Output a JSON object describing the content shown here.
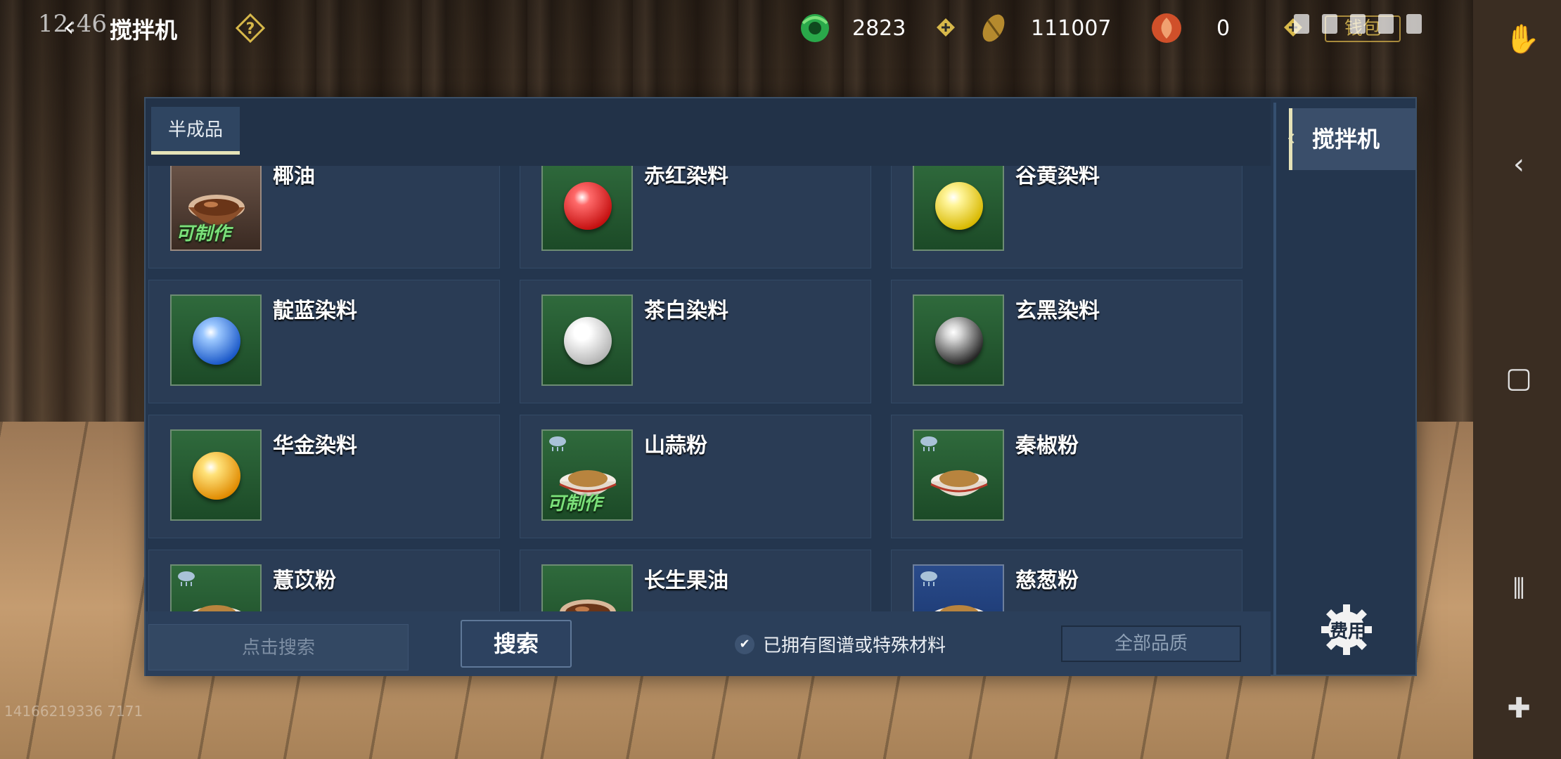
{
  "status": {
    "time": "12:46"
  },
  "header": {
    "title": "搅拌机",
    "back_icon": "back-arrow-icon",
    "help_icon": "question-diamond-icon",
    "ghost_button": "钱包"
  },
  "resources": [
    {
      "icon": "jade-coin-icon",
      "value": "2823",
      "color": "#2aa84a"
    },
    {
      "icon": "copper-coin-icon",
      "value": "111007",
      "color": "#b58a2e"
    },
    {
      "icon": "red-token-icon",
      "value": "0",
      "color": "#d0502a"
    }
  ],
  "tabs": [
    {
      "label": "半成品",
      "active": true
    }
  ],
  "side_tabs": [
    {
      "label": "搅拌机",
      "active": true
    }
  ],
  "items": [
    {
      "name": "椰油",
      "icon": "oil-bowl-icon",
      "craftable": true,
      "rain": false,
      "bg": "gray",
      "orb": "brown"
    },
    {
      "name": "赤红染料",
      "icon": "red-orb-icon",
      "craftable": false,
      "rain": false,
      "bg": "green",
      "orb": "red"
    },
    {
      "name": "谷黄染料",
      "icon": "yellow-orb-icon",
      "craftable": false,
      "rain": false,
      "bg": "green",
      "orb": "yellow"
    },
    {
      "name": "靛蓝染料",
      "icon": "blue-orb-icon",
      "craftable": false,
      "rain": false,
      "bg": "green",
      "orb": "blue"
    },
    {
      "name": "茶白染料",
      "icon": "white-orb-icon",
      "craftable": false,
      "rain": false,
      "bg": "green",
      "orb": "white"
    },
    {
      "name": "玄黑染料",
      "icon": "black-orb-icon",
      "craftable": false,
      "rain": false,
      "bg": "green",
      "orb": "black"
    },
    {
      "name": "华金染料",
      "icon": "gold-orb-icon",
      "craftable": false,
      "rain": false,
      "bg": "green",
      "orb": "gold"
    },
    {
      "name": "山蒜粉",
      "icon": "powder-bowl-icon",
      "craftable": true,
      "rain": true,
      "bg": "green",
      "orb": "powder"
    },
    {
      "name": "秦椒粉",
      "icon": "powder-bowl-icon",
      "craftable": false,
      "rain": true,
      "bg": "green",
      "orb": "powder"
    },
    {
      "name": "薏苡粉",
      "icon": "powder-bowl-icon",
      "craftable": false,
      "rain": true,
      "bg": "green",
      "orb": "powder"
    },
    {
      "name": "长生果油",
      "icon": "oil-bowl-icon",
      "craftable": false,
      "rain": false,
      "bg": "green",
      "orb": "brown"
    },
    {
      "name": "慈葱粉",
      "icon": "powder-bowl-icon",
      "craftable": false,
      "rain": true,
      "bg": "blue",
      "orb": "powder"
    }
  ],
  "craftable_label": "可制作",
  "bottom": {
    "search_placeholder": "点击搜索",
    "search_button": "搜索",
    "filter_checkbox": "已拥有图谱或特殊材料",
    "quality_button": "全部品质"
  },
  "settings_label": "费用",
  "watermark": "14166219336 7171"
}
